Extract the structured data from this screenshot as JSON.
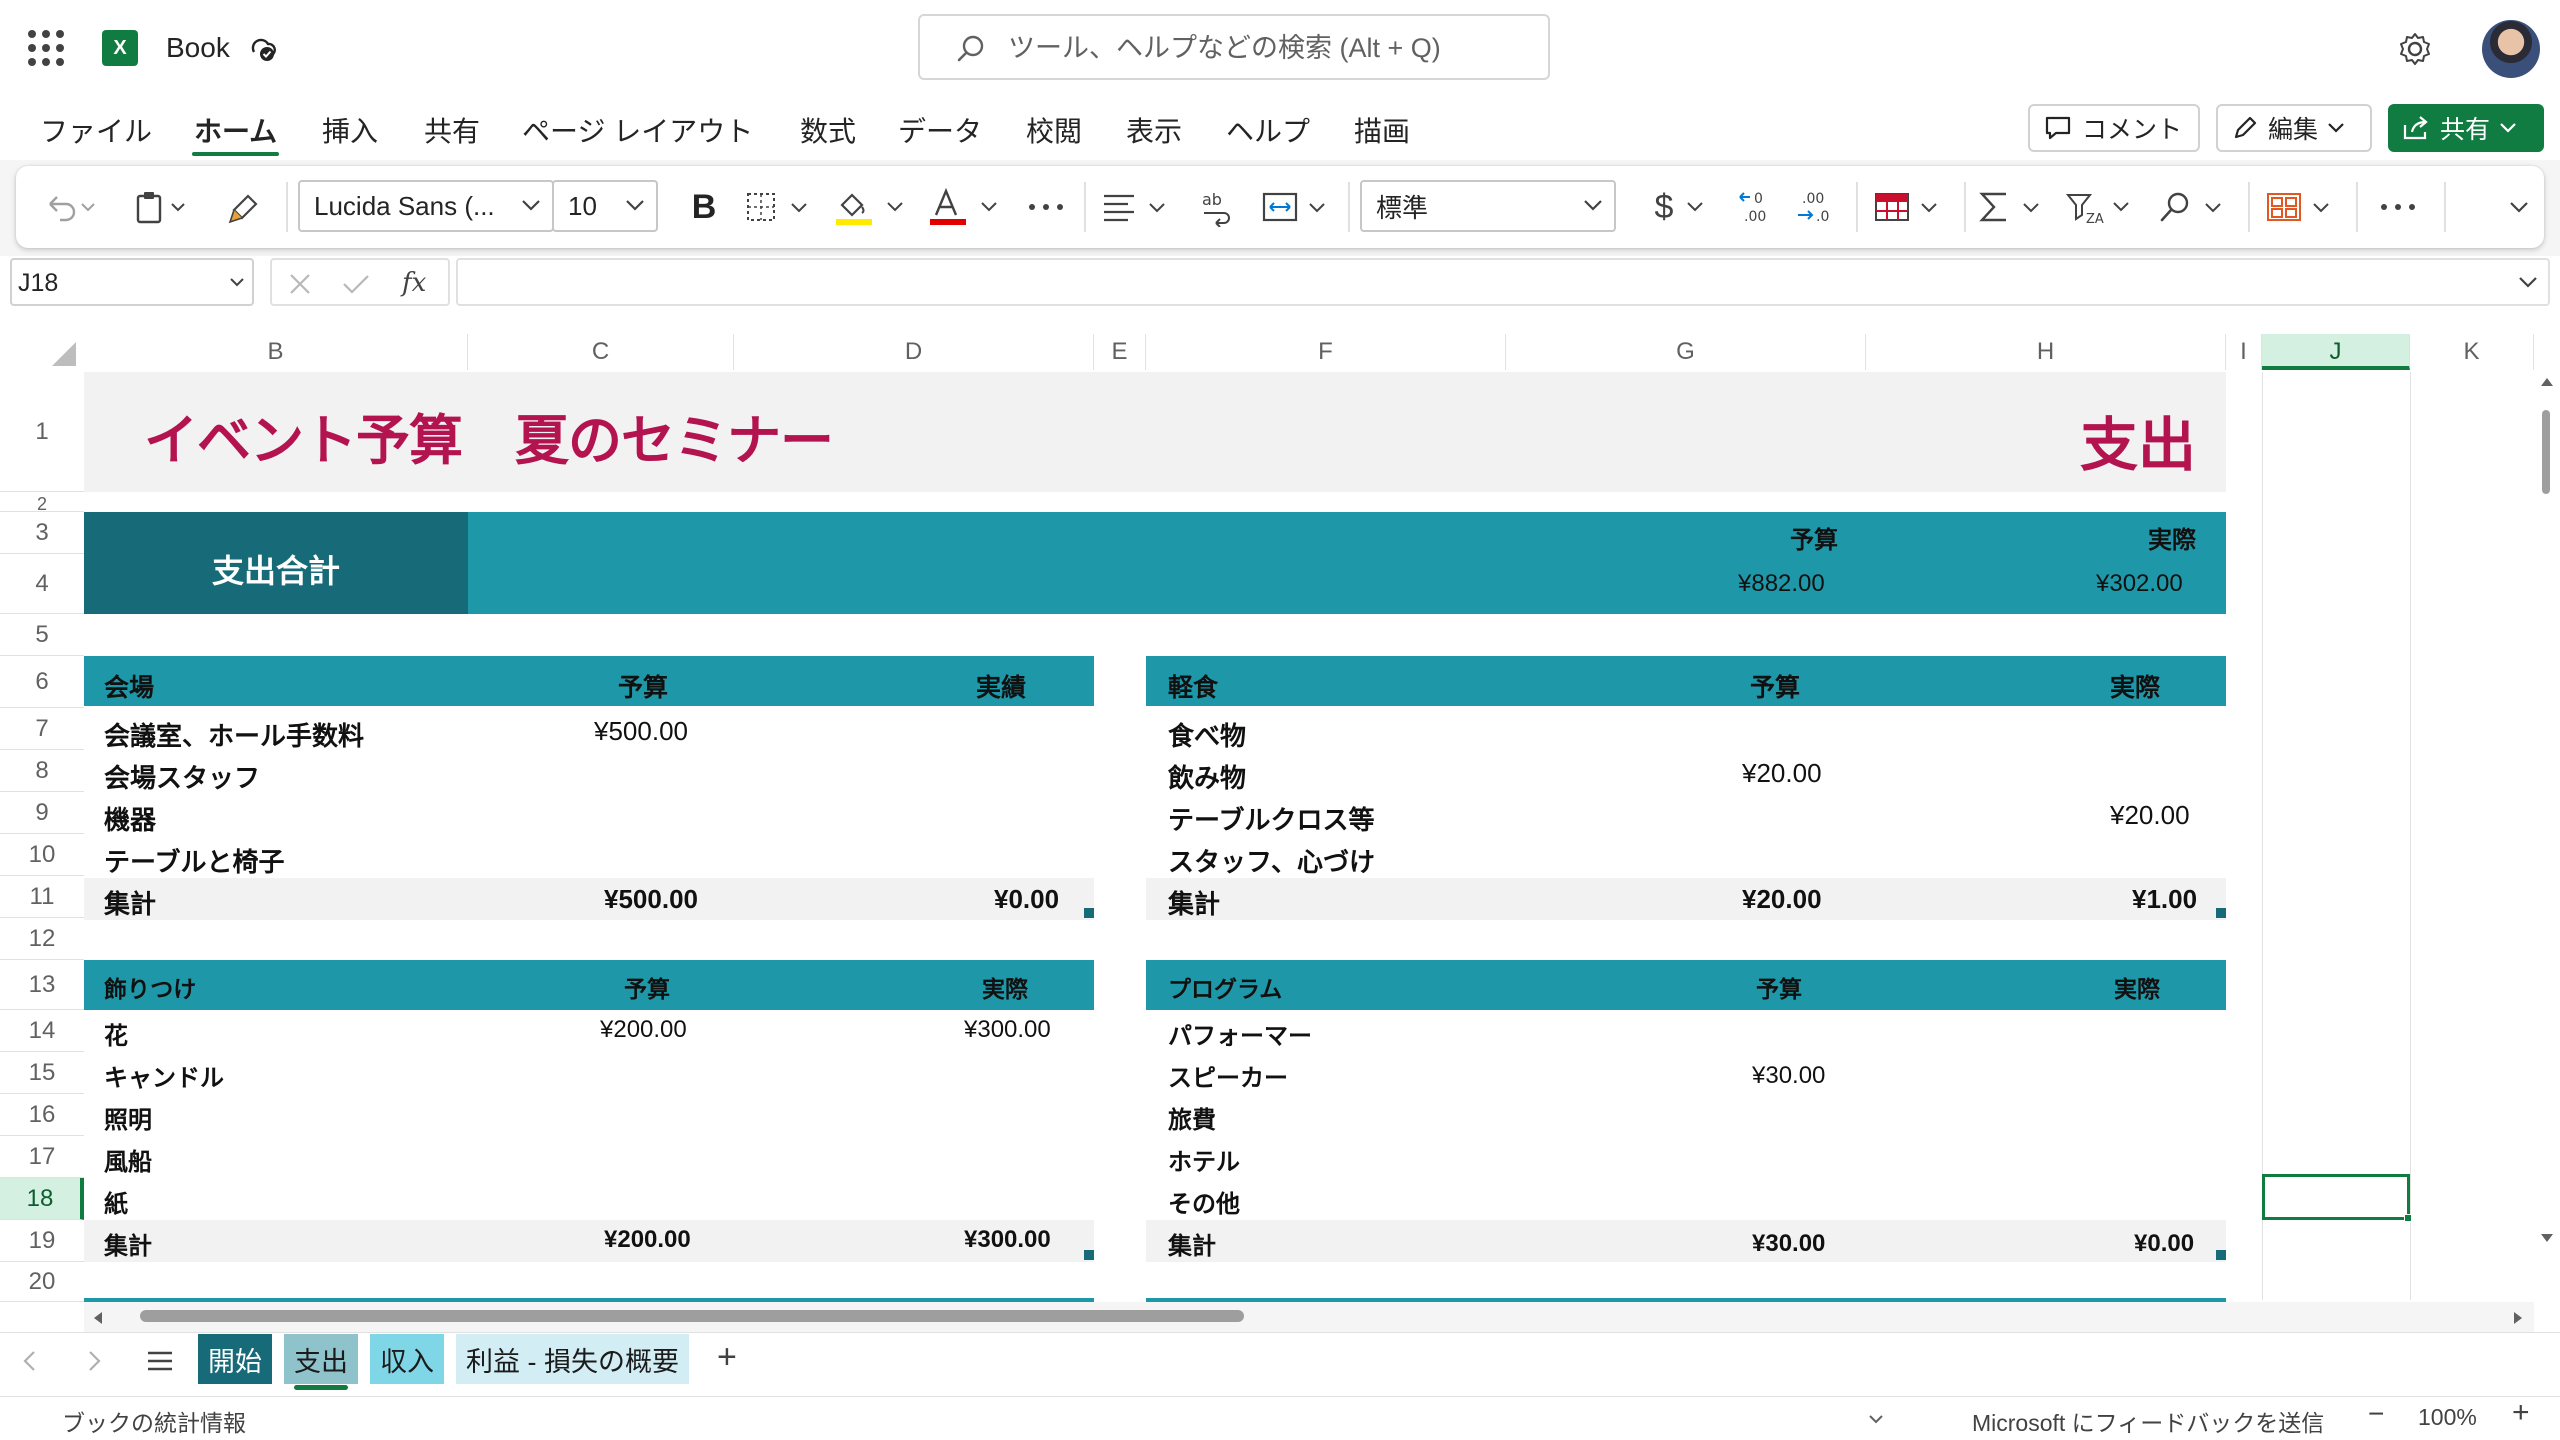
{
  "titlebar": {
    "app_name": "Book",
    "search_placeholder": "ツール、ヘルプなどの検索 (Alt + Q)"
  },
  "menu": {
    "tabs": [
      "ファイル",
      "ホーム",
      "挿入",
      "共有",
      "ページ レイアウト",
      "数式",
      "データ",
      "校閲",
      "表示",
      "ヘルプ",
      "描画"
    ],
    "active": "ホーム",
    "comment_label": "コメント",
    "edit_label": "編集",
    "share_label": "共有"
  },
  "ribbon": {
    "font_name": "Lucida Sans (...",
    "font_size": "10",
    "number_format": "標準",
    "bold_label": "B",
    "currency_label": "$"
  },
  "formula_bar": {
    "name_box": "J18",
    "fx_label": "fx",
    "formula": ""
  },
  "columns": [
    "B",
    "C",
    "D",
    "E",
    "F",
    "G",
    "H",
    "I",
    "J",
    "K"
  ],
  "selected_column": "J",
  "rows": [
    "1",
    "2",
    "3",
    "4",
    "5",
    "6",
    "7",
    "8",
    "9",
    "10",
    "11",
    "12",
    "13",
    "14",
    "15",
    "16",
    "17",
    "18",
    "19",
    "20"
  ],
  "selected_row": "18",
  "sheet": {
    "title": "イベント予算　夏のセミナー",
    "title_right": "支出",
    "summary": {
      "label": "支出合計",
      "budget_header": "予算",
      "actual_header": "実際",
      "budget_value": "¥882.00",
      "actual_value": "¥302.00"
    },
    "venue": {
      "header": "会場",
      "budget_header": "予算",
      "actual_header": "実績",
      "items": [
        {
          "name": "会議室、ホール手数料",
          "budget": "¥500.00",
          "actual": ""
        },
        {
          "name": "会場スタッフ",
          "budget": "",
          "actual": ""
        },
        {
          "name": "機器",
          "budget": "",
          "actual": ""
        },
        {
          "name": "テーブルと椅子",
          "budget": "",
          "actual": ""
        }
      ],
      "total_label": "集計",
      "total_budget": "¥500.00",
      "total_actual": "¥0.00"
    },
    "refreshments": {
      "header": "軽食",
      "budget_header": "予算",
      "actual_header": "実際",
      "items": [
        {
          "name": "食べ物",
          "budget": "",
          "actual": ""
        },
        {
          "name": "飲み物",
          "budget": "¥20.00",
          "actual": ""
        },
        {
          "name": "テーブルクロス等",
          "budget": "",
          "actual": "¥20.00"
        },
        {
          "name": "スタッフ、心づけ",
          "budget": "",
          "actual": ""
        }
      ],
      "total_label": "集計",
      "total_budget": "¥20.00",
      "total_actual": "¥1.00"
    },
    "decorations": {
      "header": "飾りつけ",
      "budget_header": "予算",
      "actual_header": "実際",
      "items": [
        {
          "name": "花",
          "budget": "¥200.00",
          "actual": "¥300.00"
        },
        {
          "name": "キャンドル",
          "budget": "",
          "actual": ""
        },
        {
          "name": "照明",
          "budget": "",
          "actual": ""
        },
        {
          "name": "風船",
          "budget": "",
          "actual": ""
        },
        {
          "name": "紙",
          "budget": "",
          "actual": ""
        }
      ],
      "total_label": "集計",
      "total_budget": "¥200.00",
      "total_actual": "¥300.00"
    },
    "program": {
      "header": "プログラム",
      "budget_header": "予算",
      "actual_header": "実際",
      "items": [
        {
          "name": "パフォーマー",
          "budget": "",
          "actual": ""
        },
        {
          "name": "スピーカー",
          "budget": "¥30.00",
          "actual": ""
        },
        {
          "name": "旅費",
          "budget": "",
          "actual": ""
        },
        {
          "name": "ホテル",
          "budget": "",
          "actual": ""
        },
        {
          "name": "その他",
          "budget": "",
          "actual": ""
        }
      ],
      "total_label": "集計",
      "total_budget": "¥30.00",
      "total_actual": "¥0.00"
    }
  },
  "sheet_tabs": [
    {
      "label": "開始",
      "bg": "#176a78",
      "color": "#ffffff"
    },
    {
      "label": "支出",
      "bg": "#8fc3cc",
      "color": "#1b1b1b"
    },
    {
      "label": "収入",
      "bg": "#7fd6e6",
      "color": "#1b1b1b"
    },
    {
      "label": "利益 - 損失の概要",
      "bg": "#d2eef4",
      "color": "#1b1b1b"
    }
  ],
  "add_sheet_label": "+",
  "status": {
    "left": "ブックの統計情報",
    "feedback": "Microsoft にフィードバックを送信",
    "zoom": "100%",
    "zoom_minus": "−",
    "zoom_plus": "+"
  },
  "colors": {
    "accent": "#107C41",
    "teal": "#1e98a8",
    "teal_dark": "#176a78",
    "title_red": "#b3134f",
    "band_gray": "#f2f2f2"
  },
  "icons": [
    "waffle-icon",
    "excel-logo-icon",
    "autosave-icon",
    "search-icon",
    "gear-icon",
    "undo-icon",
    "paste-icon",
    "format-painter-icon",
    "borders-icon",
    "fill-color-icon",
    "font-color-icon",
    "more-icon",
    "align-icon",
    "wrap-text-icon",
    "merge-icon",
    "increase-decimal-icon",
    "decrease-decimal-icon",
    "format-as-table-icon",
    "autosum-icon",
    "sort-filter-icon",
    "find-icon",
    "conditional-format-icon",
    "expand-ribbon-icon"
  ]
}
